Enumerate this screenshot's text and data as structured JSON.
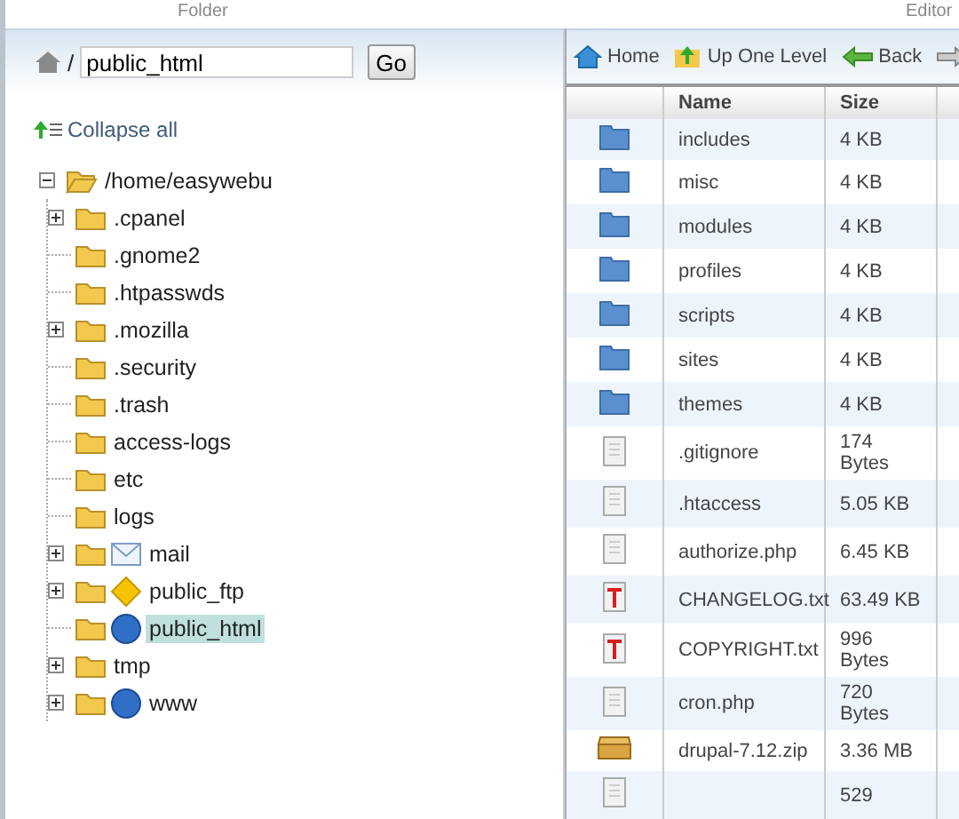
{
  "top_labels": [
    "Folder",
    "Editor"
  ],
  "path_bar": {
    "prefix": "/",
    "value": "public_html",
    "go": "Go"
  },
  "collapse_all": "Collapse all",
  "tree": [
    {
      "label": "/home/easywebu",
      "kind": "folder",
      "has_children": true,
      "expanded": true,
      "selected": false,
      "children": [
        {
          "label": ".cpanel",
          "kind": "folder",
          "has_children": true,
          "expanded": false,
          "selected": false
        },
        {
          "label": ".gnome2",
          "kind": "folder",
          "has_children": false,
          "expanded": false,
          "selected": false
        },
        {
          "label": ".htpasswds",
          "kind": "folder",
          "has_children": false,
          "expanded": false,
          "selected": false
        },
        {
          "label": ".mozilla",
          "kind": "folder",
          "has_children": true,
          "expanded": false,
          "selected": false
        },
        {
          "label": ".security",
          "kind": "folder",
          "has_children": false,
          "expanded": false,
          "selected": false
        },
        {
          "label": ".trash",
          "kind": "folder",
          "has_children": false,
          "expanded": false,
          "selected": false
        },
        {
          "label": "access-logs",
          "kind": "folder",
          "has_children": false,
          "expanded": false,
          "selected": false
        },
        {
          "label": "etc",
          "kind": "folder",
          "has_children": false,
          "expanded": false,
          "selected": false
        },
        {
          "label": "logs",
          "kind": "folder",
          "has_children": false,
          "expanded": false,
          "selected": false
        },
        {
          "label": "mail",
          "kind": "mail",
          "has_children": true,
          "expanded": false,
          "selected": false
        },
        {
          "label": "public_ftp",
          "kind": "ftp",
          "has_children": true,
          "expanded": false,
          "selected": false
        },
        {
          "label": "public_html",
          "kind": "web",
          "has_children": false,
          "expanded": false,
          "selected": true
        },
        {
          "label": "tmp",
          "kind": "folder",
          "has_children": true,
          "expanded": false,
          "selected": false
        },
        {
          "label": "www",
          "kind": "web",
          "has_children": true,
          "expanded": false,
          "selected": false
        }
      ]
    }
  ],
  "toolbar": [
    {
      "label": "Home",
      "kind": "home"
    },
    {
      "label": "Up One Level",
      "kind": "up"
    },
    {
      "label": "Back",
      "kind": "back"
    },
    {
      "kind": "forward"
    }
  ],
  "table": {
    "columns": [
      "Name",
      "Size"
    ],
    "rows": [
      {
        "kind": "folder",
        "name": "includes",
        "size": "4 KB"
      },
      {
        "kind": "folder",
        "name": "misc",
        "size": "4 KB"
      },
      {
        "kind": "folder",
        "name": "modules",
        "size": "4 KB"
      },
      {
        "kind": "folder",
        "name": "profiles",
        "size": "4 KB"
      },
      {
        "kind": "folder",
        "name": "scripts",
        "size": "4 KB"
      },
      {
        "kind": "folder",
        "name": "sites",
        "size": "4 KB"
      },
      {
        "kind": "folder",
        "name": "themes",
        "size": "4 KB"
      },
      {
        "kind": "file",
        "name": ".gitignore",
        "size": "174 Bytes"
      },
      {
        "kind": "file",
        "name": ".htaccess",
        "size": "5.05 KB"
      },
      {
        "kind": "file",
        "name": "authorize.php",
        "size": "6.45 KB"
      },
      {
        "kind": "text",
        "name": "CHANGELOG.txt",
        "size": "63.49 KB"
      },
      {
        "kind": "text",
        "name": "COPYRIGHT.txt",
        "size": "996 Bytes"
      },
      {
        "kind": "file",
        "name": "cron.php",
        "size": "720 Bytes"
      },
      {
        "kind": "archive",
        "name": "drupal-7.12.zip",
        "size": "3.36 MB"
      },
      {
        "kind": "file",
        "size": "529"
      }
    ]
  }
}
